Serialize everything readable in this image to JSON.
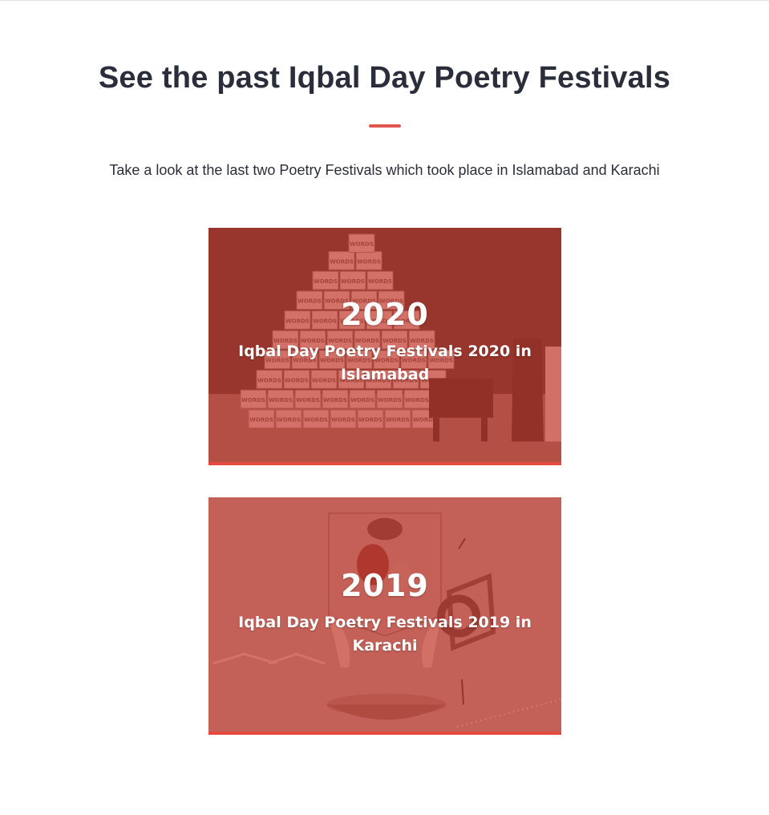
{
  "section": {
    "title": "See the past Iqbal Day Poetry Festivals",
    "subtitle": "Take a look at the last two Poetry Festivals which took place in Islamabad and Karachi",
    "accent_color": "#e2574c"
  },
  "festivals": [
    {
      "year": "2020",
      "caption": "Iqbal Day Poetry Festivals 2020 in Islamabad",
      "stack_word": "WORDS"
    },
    {
      "year": "2019",
      "caption": "Iqbal Day Poetry Festivals 2019 in Karachi"
    }
  ]
}
